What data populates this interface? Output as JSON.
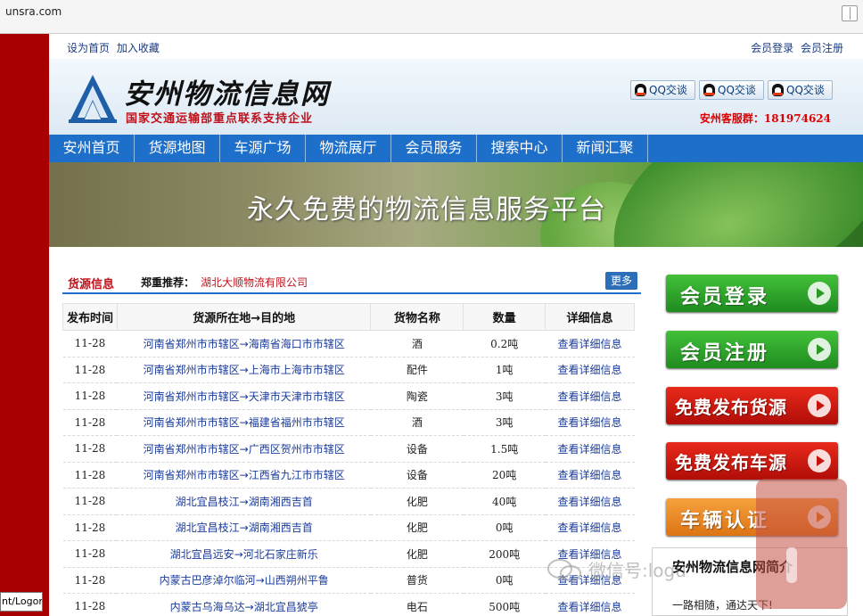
{
  "browser": {
    "url": "unsra.com"
  },
  "tooltip": "nt/Logon",
  "toplinks": {
    "left": [
      "设为首页",
      "加入收藏"
    ],
    "right": [
      "会员登录",
      "会员注册"
    ]
  },
  "header": {
    "title": "安州物流信息网",
    "subtitle": "国家交通运输部重点联系支持企业",
    "qq_buttons": [
      "QQ交谈",
      "QQ交谈",
      "QQ交谈"
    ],
    "service": "安州客服群：181974624"
  },
  "nav": [
    "安州首页",
    "货源地图",
    "车源广场",
    "物流展厅",
    "会员服务",
    "搜索中心",
    "新闻汇聚"
  ],
  "banner": {
    "slogan": "永久免费的物流信息服务平台"
  },
  "cargo": {
    "title": "货源信息",
    "recommend_label": "郑重推荐：",
    "recommend_company": "湖北大顺物流有限公司",
    "more": "更多",
    "columns": [
      "发布时间",
      "货源所在地→目的地",
      "货物名称",
      "数量",
      "详细信息"
    ],
    "rows": [
      {
        "date": "11-28",
        "route": "河南省郑州市市辖区→海南省海口市市辖区",
        "name": "酒",
        "qty": "0.2吨",
        "detail": "查看详细信息"
      },
      {
        "date": "11-28",
        "route": "河南省郑州市市辖区→上海市上海市市辖区",
        "name": "配件",
        "qty": "1吨",
        "detail": "查看详细信息"
      },
      {
        "date": "11-28",
        "route": "河南省郑州市市辖区→天津市天津市市辖区",
        "name": "陶瓷",
        "qty": "3吨",
        "detail": "查看详细信息"
      },
      {
        "date": "11-28",
        "route": "河南省郑州市市辖区→福建省福州市市辖区",
        "name": "酒",
        "qty": "3吨",
        "detail": "查看详细信息"
      },
      {
        "date": "11-28",
        "route": "河南省郑州市市辖区→广西区贺州市市辖区",
        "name": "设备",
        "qty": "1.5吨",
        "detail": "查看详细信息"
      },
      {
        "date": "11-28",
        "route": "河南省郑州市市辖区→江西省九江市市辖区",
        "name": "设备",
        "qty": "20吨",
        "detail": "查看详细信息"
      },
      {
        "date": "11-28",
        "route": "湖北宜昌枝江→湖南湘西吉首",
        "name": "化肥",
        "qty": "40吨",
        "detail": "查看详细信息"
      },
      {
        "date": "11-28",
        "route": "湖北宜昌枝江→湖南湘西吉首",
        "name": "化肥",
        "qty": "0吨",
        "detail": "查看详细信息"
      },
      {
        "date": "11-28",
        "route": "湖北宜昌远安→河北石家庄新乐",
        "name": "化肥",
        "qty": "200吨",
        "detail": "查看详细信息"
      },
      {
        "date": "11-28",
        "route": "内蒙古巴彦淖尔临河→山西朔州平鲁",
        "name": "普货",
        "qty": "0吨",
        "detail": "查看详细信息"
      },
      {
        "date": "11-28",
        "route": "内蒙古乌海乌达→湖北宜昌猇亭",
        "name": "电石",
        "qty": "500吨",
        "detail": "查看详细信息"
      }
    ]
  },
  "side_buttons": [
    {
      "label": "会员登录",
      "color": "green"
    },
    {
      "label": "会员注册",
      "color": "green"
    },
    {
      "label": "免费发布货源",
      "color": "red"
    },
    {
      "label": "免费发布车源",
      "color": "red"
    },
    {
      "label": "车辆认证",
      "color": "orange"
    }
  ],
  "intro": {
    "title": "安州物流信息网简介",
    "slogan": "一路相随，通达天下!"
  },
  "watermark": {
    "text": "微信号:logu",
    "icon": "wechat-icon"
  },
  "colors": {
    "nav": "#1e6fc9",
    "brand_red": "#c0111b",
    "left_strip": "#a80000"
  }
}
